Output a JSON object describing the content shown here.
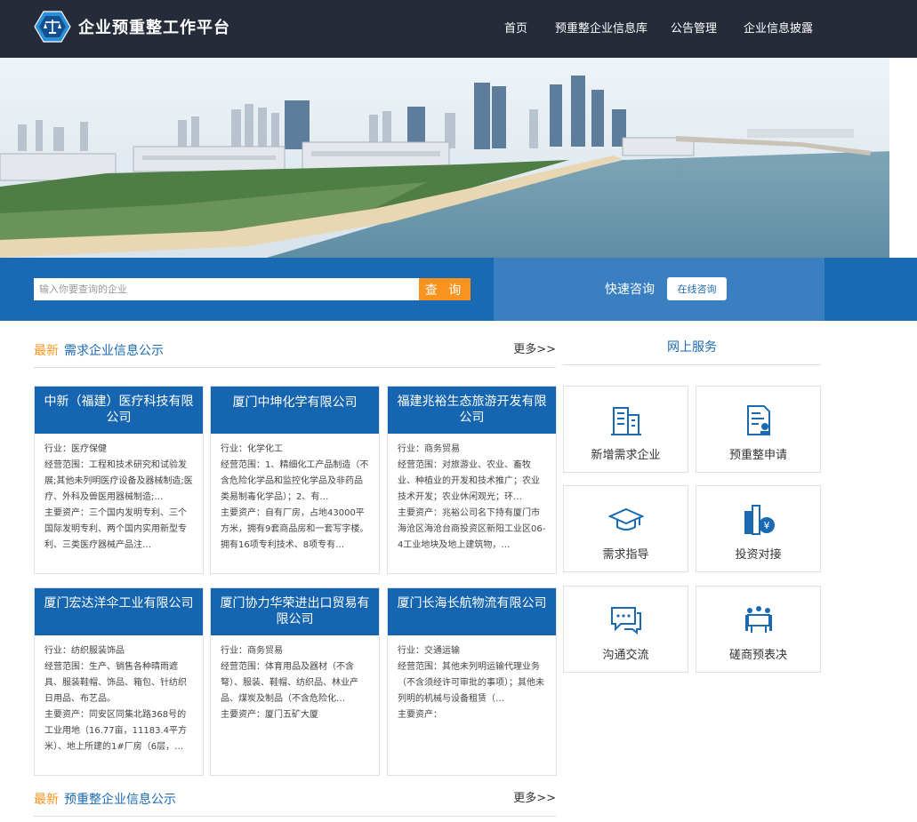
{
  "header": {
    "site_title": "企业预重整工作平台",
    "nav": [
      "首页",
      "预重整企业信息库",
      "公告管理",
      "企业信息披露"
    ]
  },
  "search": {
    "placeholder": "输入你要查询的企业",
    "button": "查 询"
  },
  "quick": {
    "label": "快速咨询",
    "button": "在线咨询"
  },
  "section1": {
    "new": "最新",
    "title": "需求企业信息公示",
    "more": "更多>>"
  },
  "section2": {
    "new": "最新",
    "title": "预重整企业信息公示",
    "more": "更多>>"
  },
  "services": {
    "title": "网上服务",
    "items": [
      {
        "label": "新增需求企业",
        "icon": "building-icon"
      },
      {
        "label": "预重整申请",
        "icon": "document-stamp-icon"
      },
      {
        "label": "需求指导",
        "icon": "graduation-cap-icon"
      },
      {
        "label": "投资对接",
        "icon": "investment-yen-icon"
      },
      {
        "label": "沟通交流",
        "icon": "chat-bubble-icon"
      },
      {
        "label": "磋商预表决",
        "icon": "meeting-icon"
      }
    ]
  },
  "cards": [
    {
      "title": "中新（福建）医疗科技有限公司",
      "industry": "行业：医疗保健",
      "scope": "经营范围：工程和技术研究和试验发展;其他未列明医疗设备及器械制造;医疗、外科及兽医用器械制造;…",
      "assets": "主要资产：三个国内发明专利、三个国际发明专利、两个国内实用新型专利、三类医疗器械产品注…"
    },
    {
      "title": "厦门中坤化学有限公司",
      "industry": "行业：化学化工",
      "scope": "经营范围：1、精细化工产品制造（不含危险化学品和监控化学品及非药品类易制毒化学品）；2、有…",
      "assets": "主要资产：自有厂房，占地43000平方米，拥有9套商品房和一套写字楼。拥有16项专利技术、8项专有…"
    },
    {
      "title": "福建兆裕生态旅游开发有限公司",
      "industry": "行业：商务贸易",
      "scope": "经营范围：对旅游业、农业、畜牧业、种植业的开发和技术推广；农业技术开发；农业休闲观光；环…",
      "assets": "主要资产：兆裕公司名下持有厦门市海沧区海沧台商投资区新阳工业区06-4工业地块及地上建筑物，…"
    },
    {
      "title": "厦门宏达洋伞工业有限公司",
      "industry": "行业：纺织服装饰品",
      "scope": "经营范围：生产、销售各种晴雨遮具、服装鞋帽、饰品、箱包、针纺织日用品、布艺品。",
      "assets": "主要资产：同安区同集北路368号的工业用地（16.77亩，11183.4平方米）、地上所建的1#厂房（6层，…"
    },
    {
      "title": "厦门协力华荣进出口贸易有限公司",
      "industry": "行业：商务贸易",
      "scope": "经营范围：体育用品及器材（不含弩）、服装、鞋帽、纺织品、林业产品、煤炭及制品（不含危险化…",
      "assets": "主要资产：厦门五矿大厦"
    },
    {
      "title": "厦门长海长航物流有限公司",
      "industry": "行业：交通运输",
      "scope": "经营范围：其他未列明运输代理业务（不含须经许可审批的事项）；其他未列明的机械与设备租赁（…",
      "assets": "主要资产："
    }
  ],
  "colors": {
    "header_bg": "#262b3a",
    "primary_blue": "#1a6ab3",
    "card_head_blue": "#1565b0",
    "accent_orange": "#f7931e",
    "quick_band": "#3a7fc1"
  }
}
